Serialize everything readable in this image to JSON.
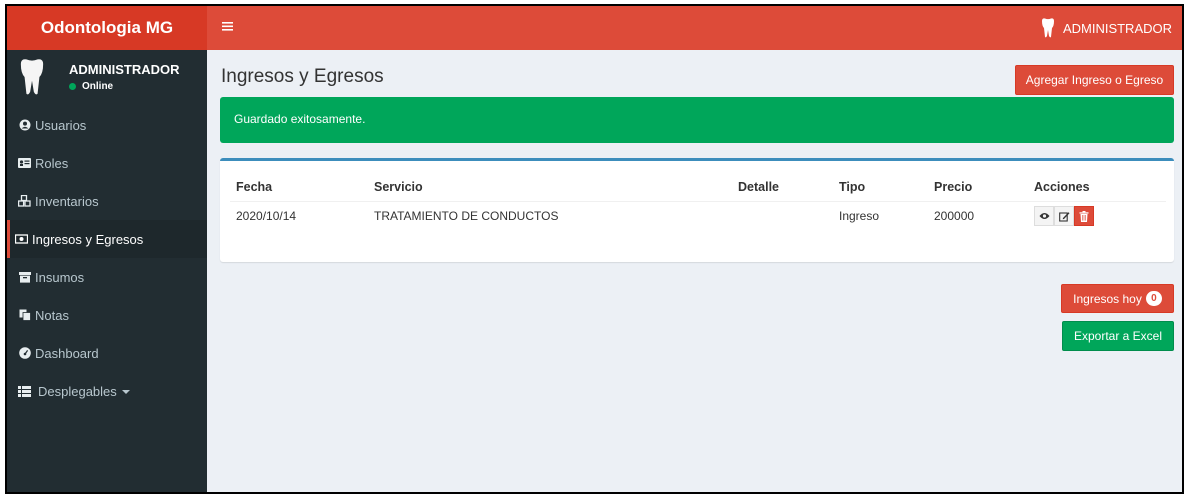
{
  "brand": {
    "title": "Odontologia MG"
  },
  "topbar": {
    "menu_icon": "hamburger-icon",
    "user_label": "ADMINISTRADOR",
    "user_icon": "tooth-icon"
  },
  "user_panel": {
    "name": "ADMINISTRADOR",
    "status": "Online"
  },
  "sidebar": {
    "items": [
      {
        "label": "Usuarios",
        "icon": "user-circle-icon"
      },
      {
        "label": "Roles",
        "icon": "id-card-icon"
      },
      {
        "label": "Inventarios",
        "icon": "cubes-icon"
      },
      {
        "label": "Ingresos y Egresos",
        "icon": "money-icon",
        "active": true
      },
      {
        "label": "Insumos",
        "icon": "archive-icon"
      },
      {
        "label": "Notas",
        "icon": "copy-icon"
      },
      {
        "label": "Dashboard",
        "icon": "dashboard-icon"
      },
      {
        "label": "Desplegables",
        "icon": "list-icon"
      }
    ]
  },
  "main": {
    "title": "Ingresos y Egresos",
    "add_button": "Agregar Ingreso o Egreso",
    "alert": "Guardado exitosamente.",
    "table": {
      "columns": [
        "Fecha",
        "Servicio",
        "Detalle",
        "Tipo",
        "Precio",
        "Acciones"
      ],
      "rows": [
        {
          "fecha": "2020/10/14",
          "servicio": "TRATAMIENTO DE CONDUCTOS",
          "detalle": "",
          "tipo": "Ingreso",
          "precio": "200000"
        }
      ]
    },
    "ingresos_hoy_label": "Ingresos hoy",
    "ingresos_hoy_count": "0",
    "export_button": "Exportar a Excel"
  },
  "colors": {
    "brand_red": "#dd4b39",
    "dark_red": "#d73925",
    "sidebar": "#222d32",
    "success": "#00a65a",
    "box_top": "#3c8dbc"
  }
}
